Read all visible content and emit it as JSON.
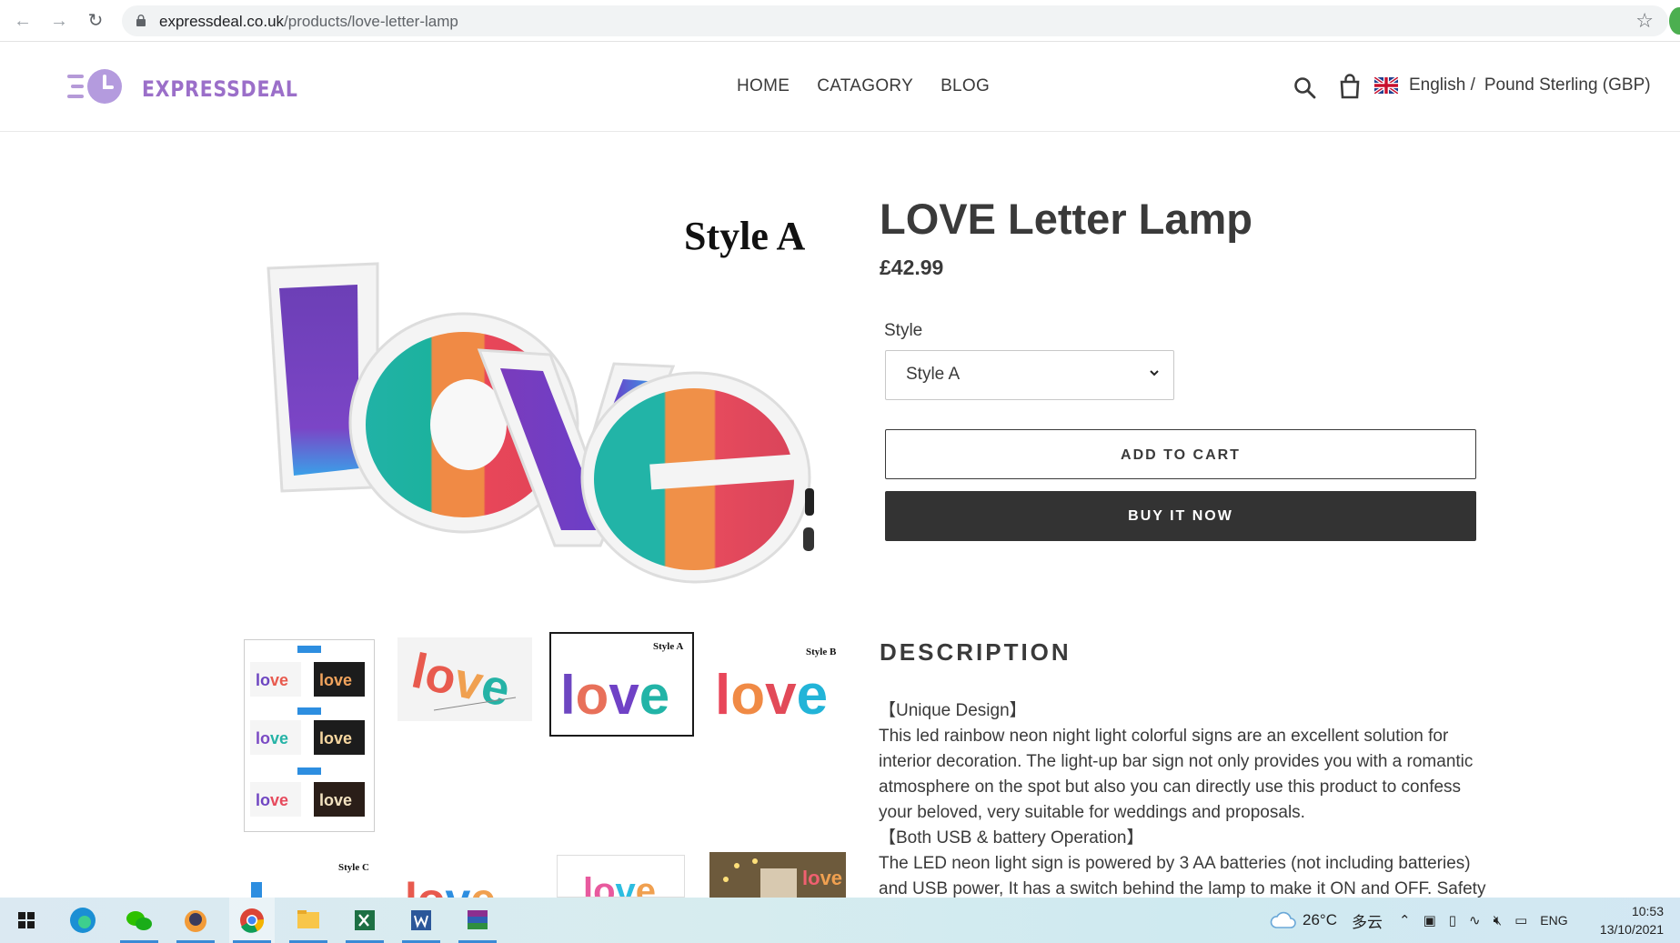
{
  "browser": {
    "url_host": "expressdeal.co.uk",
    "url_path": "/products/love-letter-lamp"
  },
  "header": {
    "logo_text": "EXPRESSDEAL",
    "menu": [
      "HOME",
      "CATAGORY",
      "BLOG"
    ],
    "language": "English /",
    "currency": "Pound Sterling (GBP)"
  },
  "gallery": {
    "main_caption": "Style A",
    "thumb_captions": [
      "Style A",
      "Style B",
      "Style C"
    ]
  },
  "product": {
    "title": "LOVE Letter Lamp",
    "price": "£42.99",
    "option_label": "Style",
    "option_value": "Style A",
    "add_to_cart": "ADD TO CART",
    "buy_now": "BUY IT NOW",
    "description_heading": "DESCRIPTION",
    "description": [
      "【Unique Design】",
      "This led rainbow neon night light colorful signs are an excellent solution for interior decoration. The light-up bar sign not only provides you with a romantic atmosphere on the spot but also you can directly use this product to confess your beloved, very suitable for weddings and proposals.",
      "【Both USB & battery Operation】",
      "The LED neon light sign is powered by 3 AA batteries (not including batteries) and USB power, It has a switch behind the lamp to make it ON and OFF. Safety"
    ]
  },
  "taskbar": {
    "weather": "26°C",
    "weather_desc": "多云",
    "lang": "ENG",
    "time": "10:53",
    "date": "13/10/2021"
  },
  "colors": {
    "brand": "#9b6fc9",
    "button_dark": "#333333",
    "text": "#3a3a3a"
  }
}
